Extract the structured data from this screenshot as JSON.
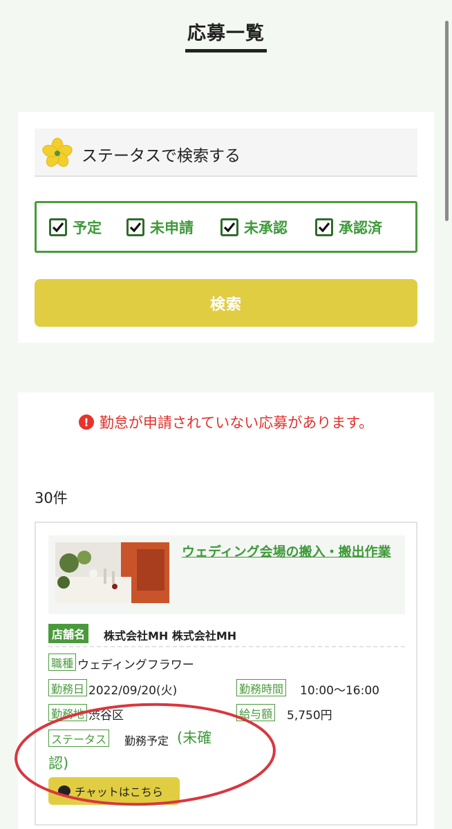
{
  "header": {
    "title": "応募一覧"
  },
  "search": {
    "heading": "ステータスで検索する",
    "statuses": [
      {
        "label": "予定",
        "checked": true
      },
      {
        "label": "未申請",
        "checked": true
      },
      {
        "label": "未承認",
        "checked": true
      },
      {
        "label": "承認済",
        "checked": true
      }
    ],
    "button_label": "検索"
  },
  "results": {
    "alert": "勤怠が申請されていない応募があります。",
    "count": "30件",
    "jobs": [
      {
        "title": "ウェディング会場の搬入・搬出作業",
        "store_tag": "店舗名",
        "store_name": "株式会社MH 株式会社MH",
        "job_type_tag": "職種",
        "job_type": "ウェディングフラワー",
        "date_tag": "勤務日",
        "date": "2022/09/20(火)",
        "time_tag": "勤務時間",
        "time": "10:00〜16:00",
        "place_tag": "勤務地",
        "place": "渋谷区",
        "pay_tag": "給与額",
        "pay": "5,750円",
        "status_tag": "ステータス",
        "status": "勤務予定",
        "status_sub_line1": "(未確",
        "status_sub_line2": "認)",
        "chat_label": "チャットはこちら"
      }
    ]
  },
  "colors": {
    "accent_green": "#4a9a3c",
    "button_yellow": "#e1cd42",
    "alert_red": "#e0312b",
    "annotation_red": "#d9363e"
  },
  "icons": [
    "flower-icon",
    "check-icon",
    "alert-icon",
    "chat-bubble-icon"
  ]
}
